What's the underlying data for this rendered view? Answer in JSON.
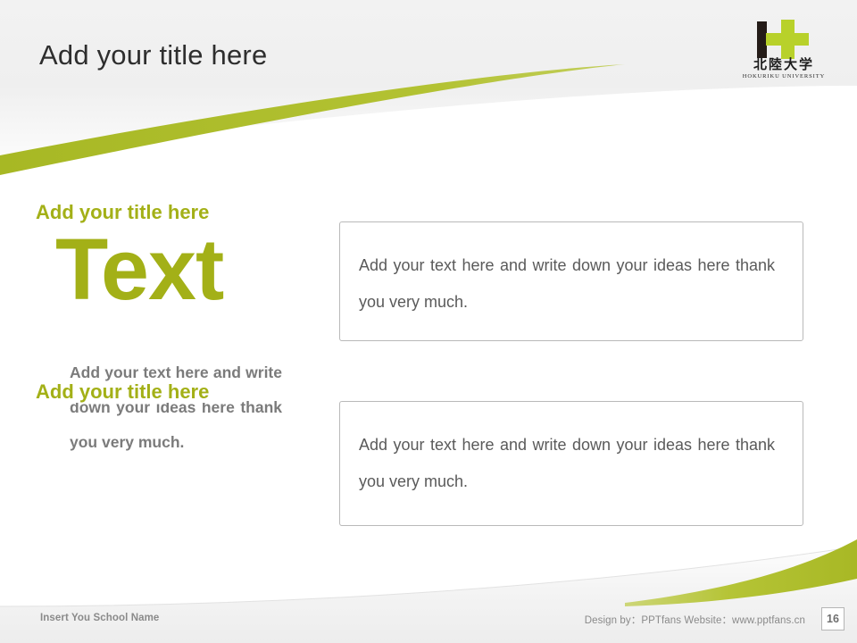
{
  "slide": {
    "title": "Add your title here",
    "page_number": "16",
    "accent_color": "#a3b017",
    "swoosh_color": "#adbc2d",
    "body_gray": "#7b7b7b",
    "title_gray": "#2e2e2e"
  },
  "logo": {
    "name_cn": "北陸大学",
    "name_en": "HOKURIKU UNIVERSITY",
    "mark_dark_color": "#241c18",
    "mark_green_color": "#b8d12a"
  },
  "left_column": {
    "headline": "Text",
    "body": "Add your text here and write down your ideas here thank you very much."
  },
  "content_boxes": [
    {
      "title": "Add your title here",
      "body": "Add your text here and write down your ideas here thank you very much."
    },
    {
      "title": "Add your title here",
      "body": "Add your text here and write down your ideas here thank you very much."
    }
  ],
  "footer": {
    "school_placeholder": "Insert You School Name",
    "credit": "Design by：PPTfans  Website：www.pptfans.cn"
  }
}
